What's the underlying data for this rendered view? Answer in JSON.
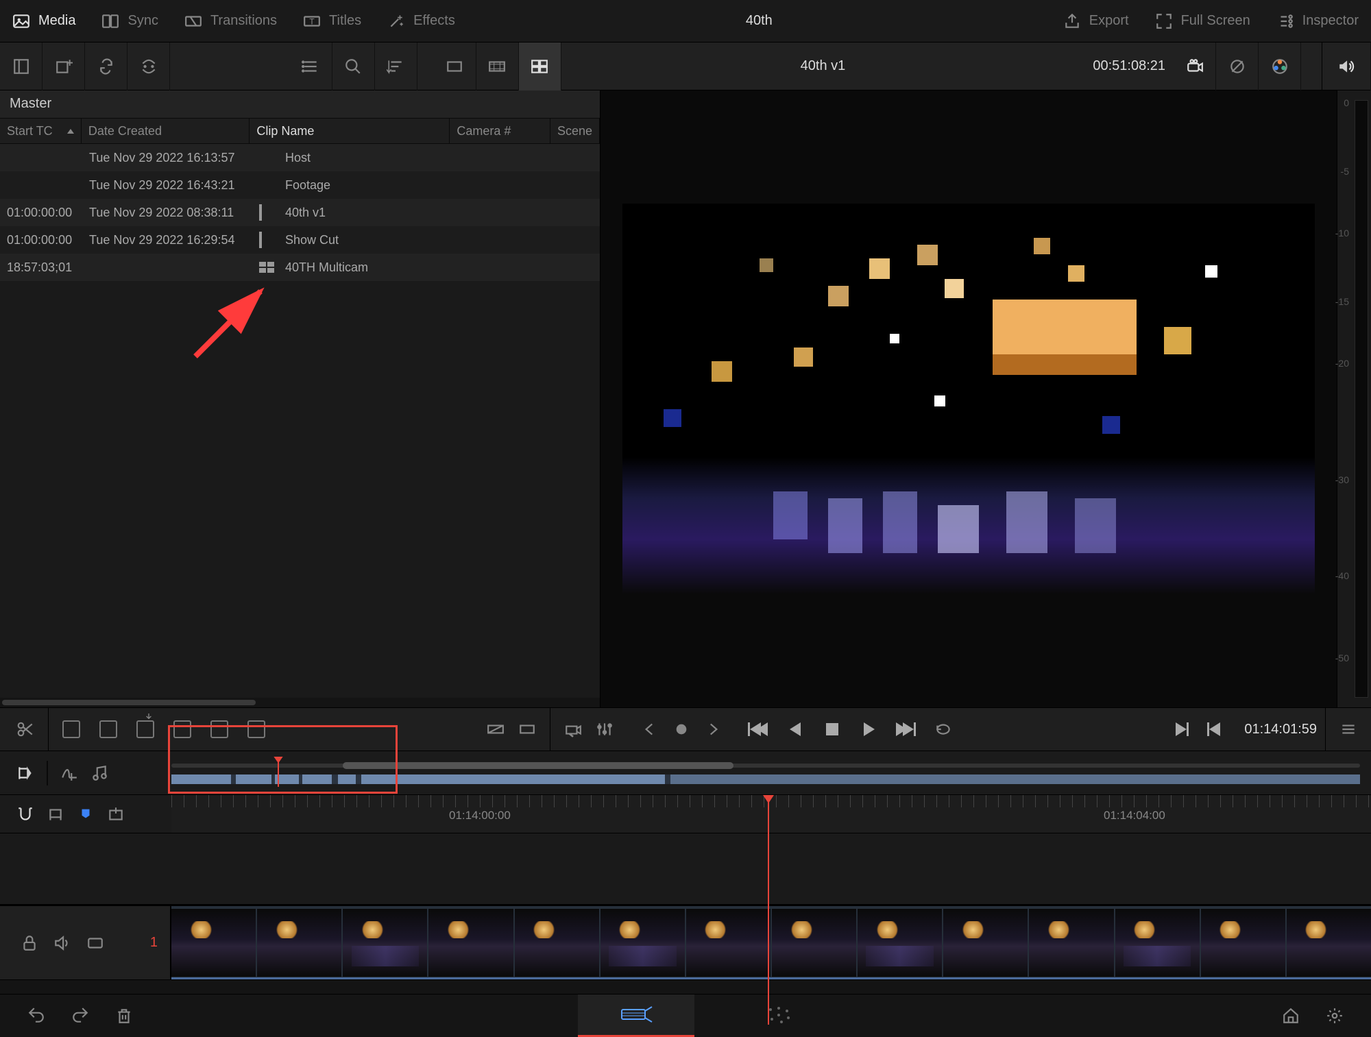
{
  "topmenu": {
    "tabs": [
      {
        "label": "Media",
        "active": true
      },
      {
        "label": "Sync"
      },
      {
        "label": "Transitions"
      },
      {
        "label": "Titles"
      },
      {
        "label": "Effects"
      }
    ],
    "project_title": "40th",
    "right": [
      {
        "label": "Export"
      },
      {
        "label": "Full Screen"
      },
      {
        "label": "Inspector"
      }
    ]
  },
  "viewer": {
    "clip_title": "40th v1",
    "source_tc": "00:51:08:21"
  },
  "mediapool": {
    "bin": "Master",
    "columns": {
      "start_tc": "Start TC",
      "date_created": "Date Created",
      "clip_name": "Clip Name",
      "camera": "Camera #",
      "scene": "Scene"
    },
    "rows": [
      {
        "start": "",
        "date": "Tue Nov 29 2022 16:13:57",
        "type": "folder",
        "name": "Host"
      },
      {
        "start": "",
        "date": "Tue Nov 29 2022 16:43:21",
        "type": "folder",
        "name": "Footage"
      },
      {
        "start": "01:00:00:00",
        "date": "Tue Nov 29 2022 08:38:11",
        "type": "timeline",
        "name": "40th v1"
      },
      {
        "start": "01:00:00:00",
        "date": "Tue Nov 29 2022 16:29:54",
        "type": "timeline",
        "name": "Show Cut"
      },
      {
        "start": "18:57:03;01",
        "date": "",
        "type": "multicam",
        "name": "40TH  Multicam"
      }
    ]
  },
  "audiometer": {
    "ticks": [
      "0",
      "-5",
      "-10",
      "-15",
      "-20",
      "-30",
      "-40",
      "-50"
    ]
  },
  "transport": {
    "record_tc": "01:14:01:59"
  },
  "ruler": {
    "labels": [
      {
        "text": "01:14:00:00",
        "pos": 405
      },
      {
        "text": "01:14:04:00",
        "pos": 1360
      }
    ]
  },
  "track": {
    "number": "1"
  }
}
